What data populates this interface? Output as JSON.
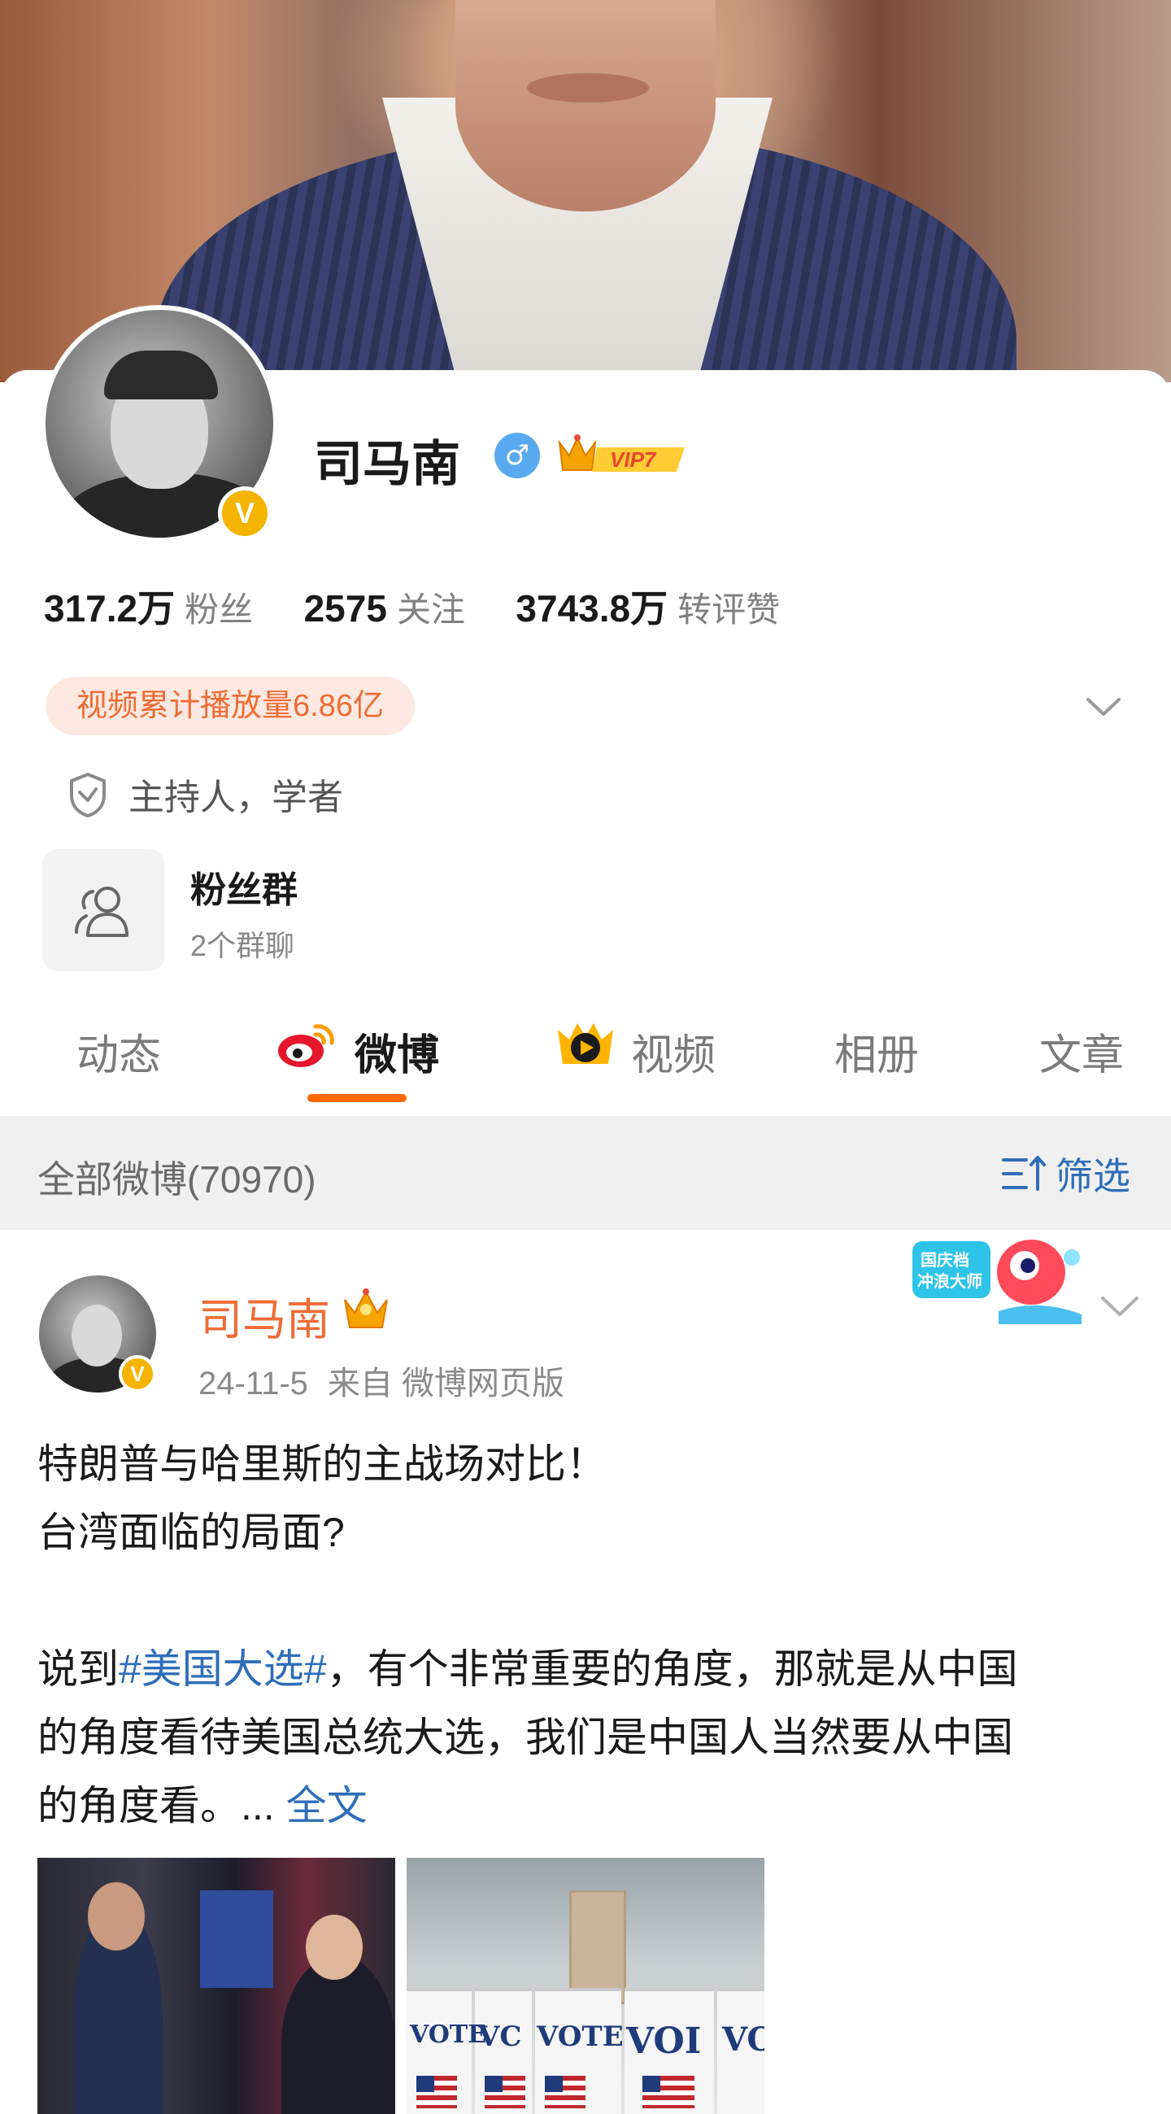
{
  "profile": {
    "name": "司马南",
    "gender_symbol": "♂",
    "vip_label": "VIP7",
    "verified_mark": "V",
    "stats": [
      {
        "value": "317.2万",
        "label": "粉丝"
      },
      {
        "value": "2575",
        "label": "关注"
      },
      {
        "value": "3743.8万",
        "label": "转评赞"
      }
    ],
    "play_count": "视频累计播放量6.86亿",
    "role": "主持人，学者",
    "fan_group": {
      "title": "粉丝群",
      "subtitle": "2个群聊"
    }
  },
  "tabs": [
    {
      "label": "动态",
      "active": false
    },
    {
      "label": "微博",
      "active": true
    },
    {
      "label": "视频",
      "active": false
    },
    {
      "label": "相册",
      "active": false
    },
    {
      "label": "文章",
      "active": false
    }
  ],
  "filter": {
    "count_label": "全部微博(70970)",
    "filter_label": "筛选"
  },
  "post": {
    "author": "司马南",
    "date": "24-11-5",
    "source": "来自 微博网页版",
    "badge_text": "国庆档冲浪大师",
    "lines": [
      "特朗普与哈里斯的主战场对比！",
      "台湾面临的局面?"
    ],
    "para_prefix": "说到",
    "topic": "#美国大选#",
    "para_line1_rest": "，有个非常重要的角度，那就是从中国",
    "para_line2": "的角度看待美国总统大选，我们是中国人当然要从中国",
    "para_line3": "的角度看。...",
    "more_label": "全文",
    "images": [
      {
        "name": "rally-photo"
      },
      {
        "name": "voting-booth-photo",
        "vote_words": [
          "VOTE",
          "VC",
          "VOTE",
          "VOI",
          "VO"
        ]
      }
    ]
  },
  "colors": {
    "accent": "#ff6a00",
    "link": "#2f6db8",
    "orange_text": "#ef6c35",
    "verified": "#f5b400"
  }
}
